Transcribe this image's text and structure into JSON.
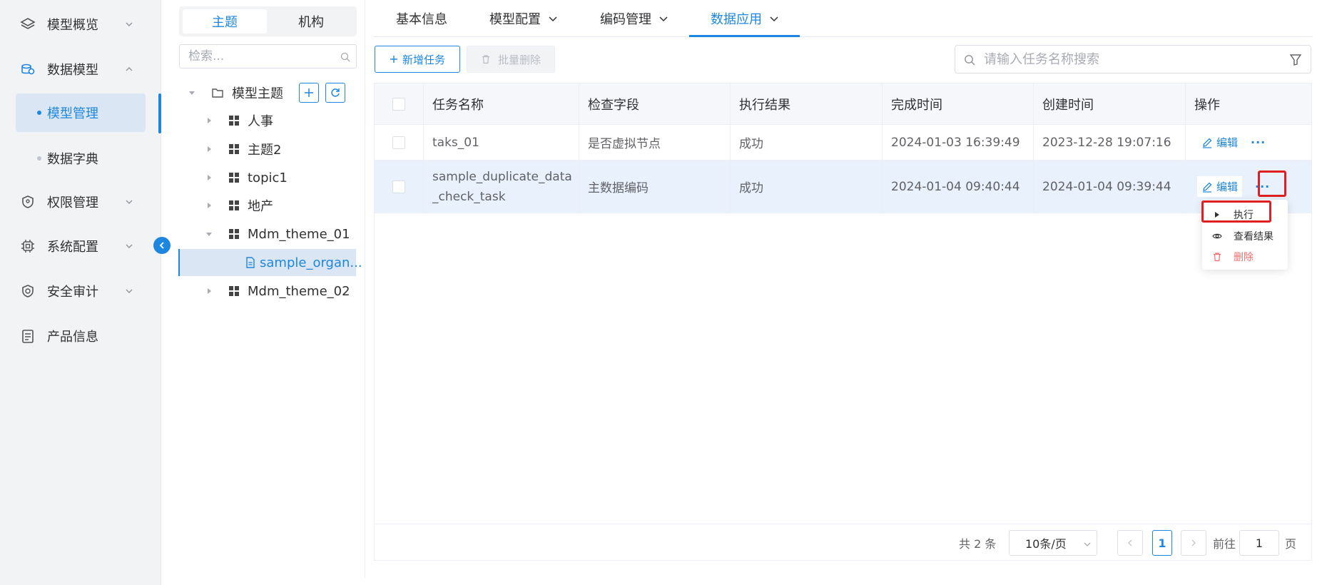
{
  "sidebar": {
    "items": [
      {
        "label": "模型概览",
        "icon": "layers-icon",
        "expanded": false
      },
      {
        "label": "数据模型",
        "icon": "database-icon",
        "expanded": true,
        "children": [
          {
            "label": "模型管理",
            "active": true
          },
          {
            "label": "数据字典",
            "active": false
          }
        ]
      },
      {
        "label": "权限管理",
        "icon": "shield-icon",
        "expanded": false
      },
      {
        "label": "系统配置",
        "icon": "chip-icon",
        "expanded": false
      },
      {
        "label": "安全审计",
        "icon": "audit-shield-icon",
        "expanded": false
      },
      {
        "label": "产品信息",
        "icon": "document-list-icon"
      }
    ]
  },
  "tree": {
    "segments": [
      "主题",
      "机构"
    ],
    "active_segment": "主题",
    "search_placeholder": "检索...",
    "root": "模型主题",
    "nodes": [
      "人事",
      "主题2",
      "topic1",
      "地产",
      "Mdm_theme_01",
      "sample_organ...",
      "Mdm_theme_02"
    ]
  },
  "tabs": [
    {
      "label": "基本信息"
    },
    {
      "label": "模型配置"
    },
    {
      "label": "编码管理"
    },
    {
      "label": "数据应用",
      "active": true
    }
  ],
  "toolbar": {
    "add_label": "新增任务",
    "batch_delete_label": "批量删除",
    "search_placeholder": "请输入任务名称搜索"
  },
  "table": {
    "columns": [
      "任务名称",
      "检查字段",
      "执行结果",
      "完成时间",
      "创建时间",
      "操作"
    ],
    "rows": [
      {
        "name": "taks_01",
        "field": "是否虚拟节点",
        "result": "成功",
        "done": "2024-01-03 16:39:49",
        "created": "2023-12-28 19:07:16"
      },
      {
        "name_line1": "sample_duplicate_data",
        "name_line2": "_check_task",
        "field": "主数据编码",
        "result": "成功",
        "done": "2024-01-04 09:40:44",
        "created": "2024-01-04 09:39:44"
      }
    ],
    "edit_label": "编辑",
    "more_label": "···"
  },
  "dropdown": {
    "items": [
      {
        "label": "执行",
        "icon": "play-icon"
      },
      {
        "label": "查看结果",
        "icon": "eye-icon"
      },
      {
        "label": "删除",
        "icon": "trash-icon"
      }
    ]
  },
  "pager": {
    "total": "共 2 条",
    "page_size": "10条/页",
    "current": "1",
    "goto_prefix": "前往",
    "goto_value": "1",
    "goto_suffix": "页"
  },
  "colors": {
    "accent": "#1d87e0",
    "danger": "#e02020",
    "delete_text": "#f56c6c"
  }
}
